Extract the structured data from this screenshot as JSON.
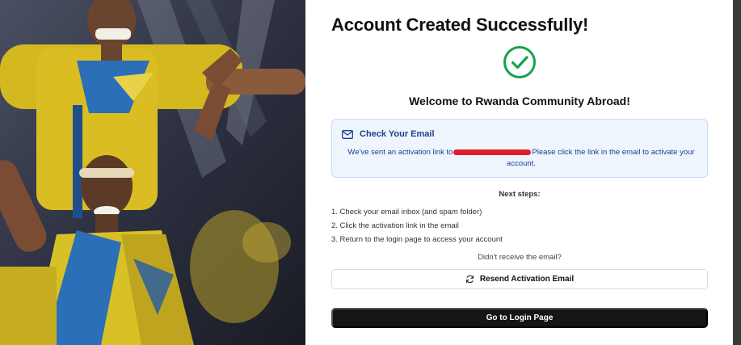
{
  "page": {
    "title": "Account Created Successfully!",
    "welcome": "Welcome to Rwanda Community Abroad!"
  },
  "email_notice": {
    "icon": "mail-icon",
    "heading": "Check Your Email",
    "message_before": "We've sent an activation link to",
    "message_after": "Please click the link in the email to activate your account."
  },
  "next_steps": {
    "heading": "Next steps:",
    "items": [
      "1. Check your email inbox (and spam folder)",
      "2. Click the activation link in the email",
      "3. Return to the login page to access your account"
    ]
  },
  "resend": {
    "prompt": "Didn't receive the email?",
    "button_label": "Resend Activation Email",
    "icon": "refresh-icon"
  },
  "login_button": {
    "label": "Go to Login Page"
  },
  "colors": {
    "success_green": "#16a34a",
    "info_bg": "#eef5fd",
    "info_text": "#1d3f8e",
    "primary_button": "#151515",
    "redaction": "#e11d2e"
  }
}
